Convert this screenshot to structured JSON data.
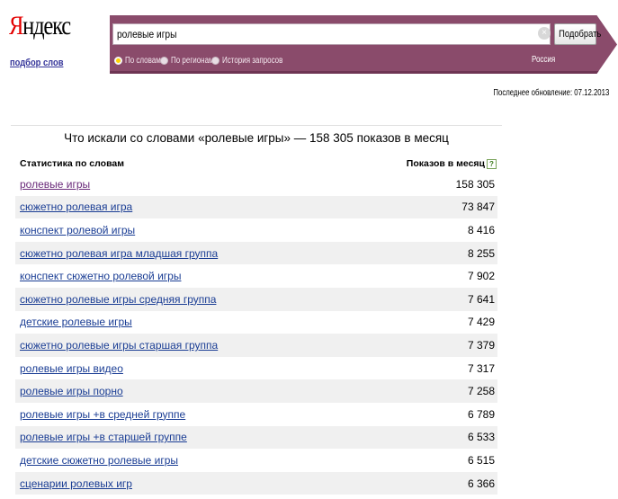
{
  "logo": {
    "first": "Я",
    "rest": "ндекс"
  },
  "service_link": "подбор слов",
  "search": {
    "query": "ролевые игры",
    "clear_icon": "close-icon",
    "button": "Подобрать"
  },
  "modes": [
    {
      "label": "По словам",
      "selected": true
    },
    {
      "label": "По регионам",
      "selected": false
    },
    {
      "label": "История запросов",
      "selected": false
    }
  ],
  "region": "Россия",
  "updated": "Последнее обновление: 07.12.2013",
  "results": {
    "title": "Что искали со словами «ролевые игры» — 158 305 показов в месяц",
    "col_phrase": "Статистика по словам",
    "col_count": "Показов в месяц",
    "help_icon": "?",
    "rows": [
      {
        "phrase": "ролевые игры",
        "count": "158 305"
      },
      {
        "phrase": "сюжетно ролевая игра",
        "count": "73 847"
      },
      {
        "phrase": "конспект ролевой игры",
        "count": "8 416"
      },
      {
        "phrase": "сюжетно ролевая игра младшая группа",
        "count": "8 255"
      },
      {
        "phrase": "конспект сюжетно ролевой игры",
        "count": "7 902"
      },
      {
        "phrase": "сюжетно ролевые игры средняя группа",
        "count": "7 641"
      },
      {
        "phrase": "детские ролевые игры",
        "count": "7 429"
      },
      {
        "phrase": "сюжетно ролевые игры старшая группа",
        "count": "7 379"
      },
      {
        "phrase": "ролевые игры видео",
        "count": "7 317"
      },
      {
        "phrase": "ролевые игры порно",
        "count": "7 258"
      },
      {
        "phrase": "ролевые игры +в средней группе",
        "count": "6 789"
      },
      {
        "phrase": "ролевые игры +в старшей группе",
        "count": "6 533"
      },
      {
        "phrase": "детские сюжетно ролевые игры",
        "count": "6 515"
      },
      {
        "phrase": "сценарии ролевых игр",
        "count": "6 366"
      }
    ]
  }
}
